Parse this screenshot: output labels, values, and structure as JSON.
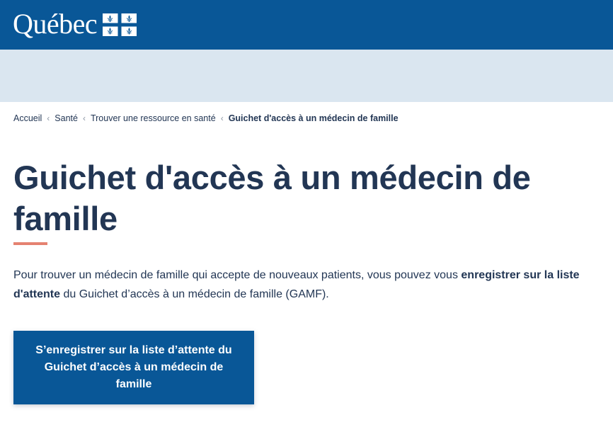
{
  "header": {
    "logo_text": "Québec",
    "brand_color": "#095797",
    "flag_icon": "fleurdelise-flag-icon"
  },
  "subheader": {
    "color": "#dae6f0"
  },
  "breadcrumb": {
    "items": [
      {
        "label": "Accueil"
      },
      {
        "label": "Santé"
      },
      {
        "label": "Trouver une ressource en santé"
      }
    ],
    "current": "Guichet d'accès à un médecin de famille",
    "separator_icon": "chevron-left-icon"
  },
  "page": {
    "title": "Guichet d'accès à un médecin de famille",
    "accent_color": "#e58271",
    "intro": {
      "part1": "Pour trouver un médecin de famille qui accepte de nouveaux patients, vous pouvez vous ",
      "bold": "enregistrer sur la liste d'attente",
      "part2": " du Guichet d’accès à un médecin de famille (GAMF)."
    },
    "cta_label": "S’enregistrer sur la liste d’attente du Guichet d’accès à un médecin de famille"
  }
}
